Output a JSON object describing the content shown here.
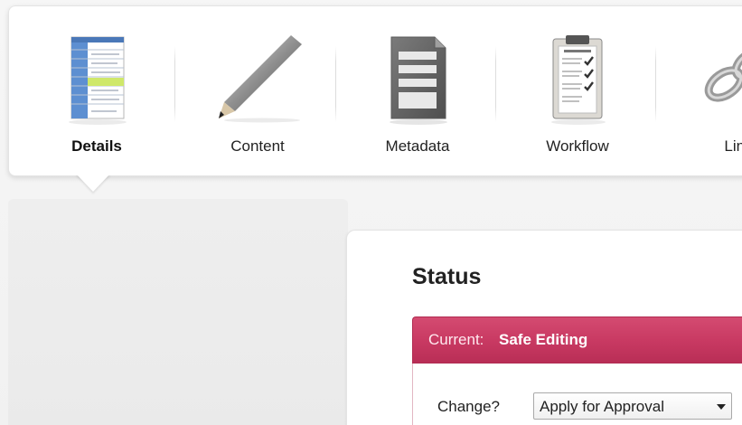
{
  "toolbar": {
    "items": [
      {
        "label": "Details",
        "icon": "details-icon",
        "active": true
      },
      {
        "label": "Content",
        "icon": "pencil-icon",
        "active": false
      },
      {
        "label": "Metadata",
        "icon": "metadata-form-icon",
        "active": false
      },
      {
        "label": "Workflow",
        "icon": "workflow-clipboard-icon",
        "active": false
      },
      {
        "label": "Link",
        "icon": "chain-link-icon",
        "active": false
      }
    ]
  },
  "status": {
    "title": "Status",
    "current_label": "Current:",
    "current_value": "Safe Editing",
    "change_label": "Change?",
    "change_selected": "Apply for Approval",
    "banner_color": "#c93a63"
  }
}
